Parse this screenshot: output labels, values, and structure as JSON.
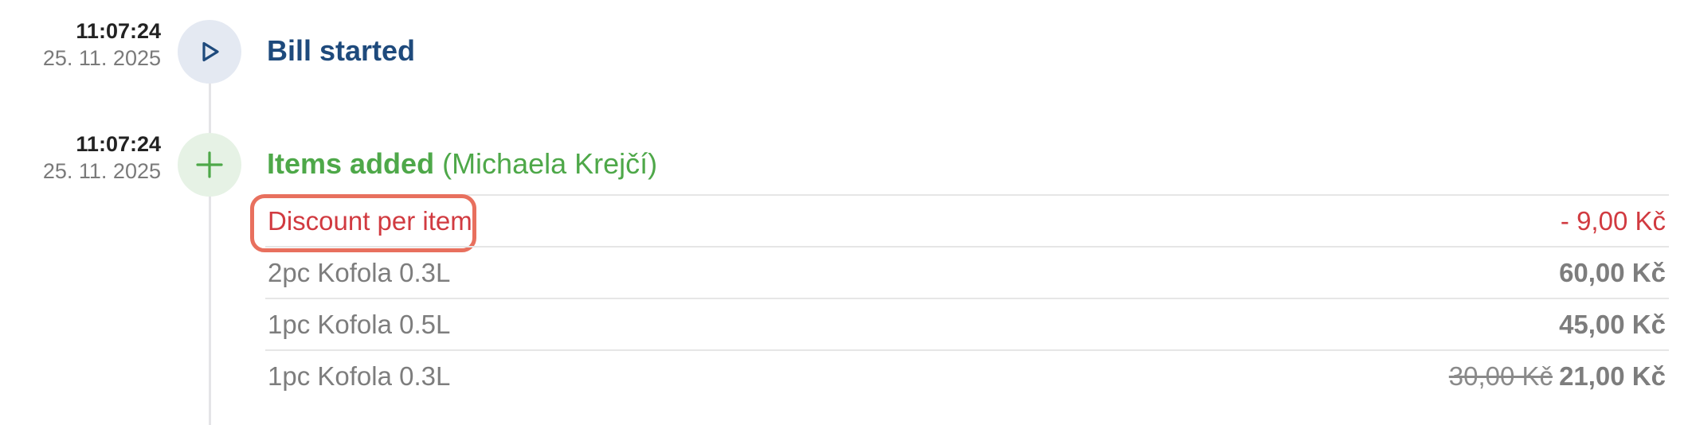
{
  "colors": {
    "title_blue": "#1e4a7c",
    "title_green": "#4ea849",
    "discount_red": "#d13a40",
    "highlight_box": "#e8705e",
    "timeline_line": "#e4e4e7"
  },
  "events": [
    {
      "time": "11:07:24",
      "date": "25. 11. 2025",
      "icon": "play-icon",
      "title": "Bill started"
    },
    {
      "time": "11:07:24",
      "date": "25. 11. 2025",
      "icon": "plus-icon",
      "title": "Items added",
      "user": "(Michaela Krejčí)",
      "items": [
        {
          "name": "Discount per item",
          "price": "- 9,00 Kč",
          "type": "discount",
          "highlighted": true
        },
        {
          "name": "2pc Kofola 0.3L",
          "price": "60,00 Kč"
        },
        {
          "name": "1pc Kofola 0.5L",
          "price": "45,00 Kč"
        },
        {
          "name": "1pc Kofola 0.3L",
          "price_original": "30,00 Kč",
          "price": "21,00 Kč"
        }
      ]
    }
  ]
}
